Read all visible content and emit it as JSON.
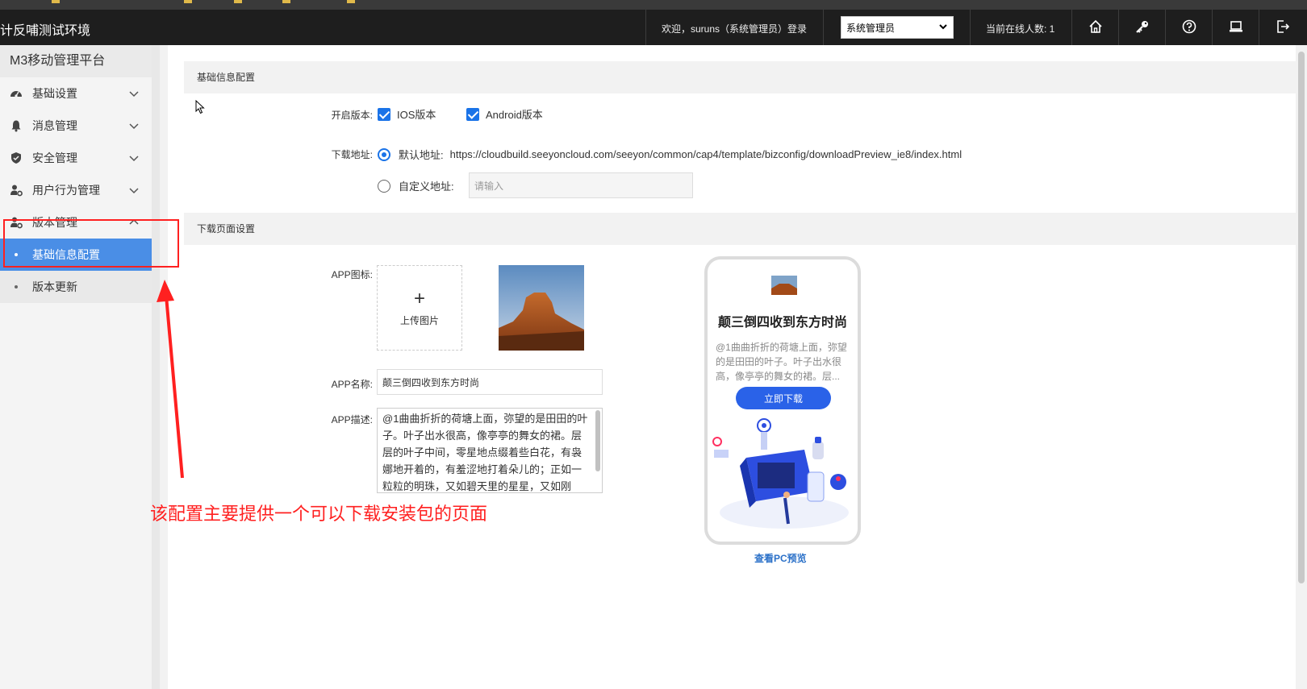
{
  "topbar": {
    "app_title": "计反哺测试环境",
    "welcome_text": "欢迎，suruns（系统管理员）登录",
    "role_select_value": "系统管理员",
    "online_text": "当前在线人数: 1",
    "tools": [
      "home-icon",
      "key-icon",
      "help-icon",
      "laptop-icon",
      "logout-icon"
    ]
  },
  "sidebar": {
    "brand": "M3移动管理平台",
    "items": [
      {
        "label": "基础设置",
        "icon": "dashboard-icon",
        "expanded": false
      },
      {
        "label": "消息管理",
        "icon": "bell-icon",
        "expanded": false
      },
      {
        "label": "安全管理",
        "icon": "shield-icon",
        "expanded": false
      },
      {
        "label": "用户行为管理",
        "icon": "user-gear-icon",
        "expanded": false
      },
      {
        "label": "版本管理",
        "icon": "user-gear-icon",
        "expanded": true
      }
    ],
    "sub_items": [
      {
        "label": "基础信息配置",
        "active": true
      },
      {
        "label": "版本更新",
        "active": false
      }
    ]
  },
  "basic_section": {
    "title": "基础信息配置",
    "version_label": "开启版本:",
    "ios_label": "IOS版本",
    "android_label": "Android版本",
    "download_label": "下载地址:",
    "default_label": "默认地址:",
    "default_url": "https://cloudbuild.seeyoncloud.com/seeyon/common/cap4/template/bizconfig/downloadPreview_ie8/index.html",
    "custom_label": "自定义地址:",
    "custom_placeholder": "请输入"
  },
  "download_section": {
    "title": "下载页面设置",
    "icon_label": "APP图标:",
    "upload_text": "上传图片",
    "upload_plus": "+",
    "name_label": "APP名称:",
    "name_value": "颠三倒四收到东方时尚",
    "desc_label": "APP描述:",
    "desc_value": "@1曲曲折折的荷塘上面，弥望的是田田的叶子。叶子出水很高，像亭亭的舞女的裙。层层的叶子中间，零星地点缀着些白花，有袅娜地开着的，有羞涩地打着朵儿的；正如一粒粒的明珠，又如碧天里的星星，又如刚"
  },
  "preview": {
    "title": "颠三倒四收到东方时尚",
    "desc": "@1曲曲折折的荷塘上面，弥望的是田田的叶子。叶子出水很高，像亭亭的舞女的裙。层...",
    "button": "立即下载",
    "pc_link": "查看PC预览"
  },
  "annotation": {
    "text": "该配置主要提供一个可以下载安装包的页面",
    "color": "#ff2020"
  },
  "colors": {
    "topbar_bg": "#1e1e1e",
    "active_menu": "#4a8ee6",
    "primary": "#2a62e8"
  }
}
